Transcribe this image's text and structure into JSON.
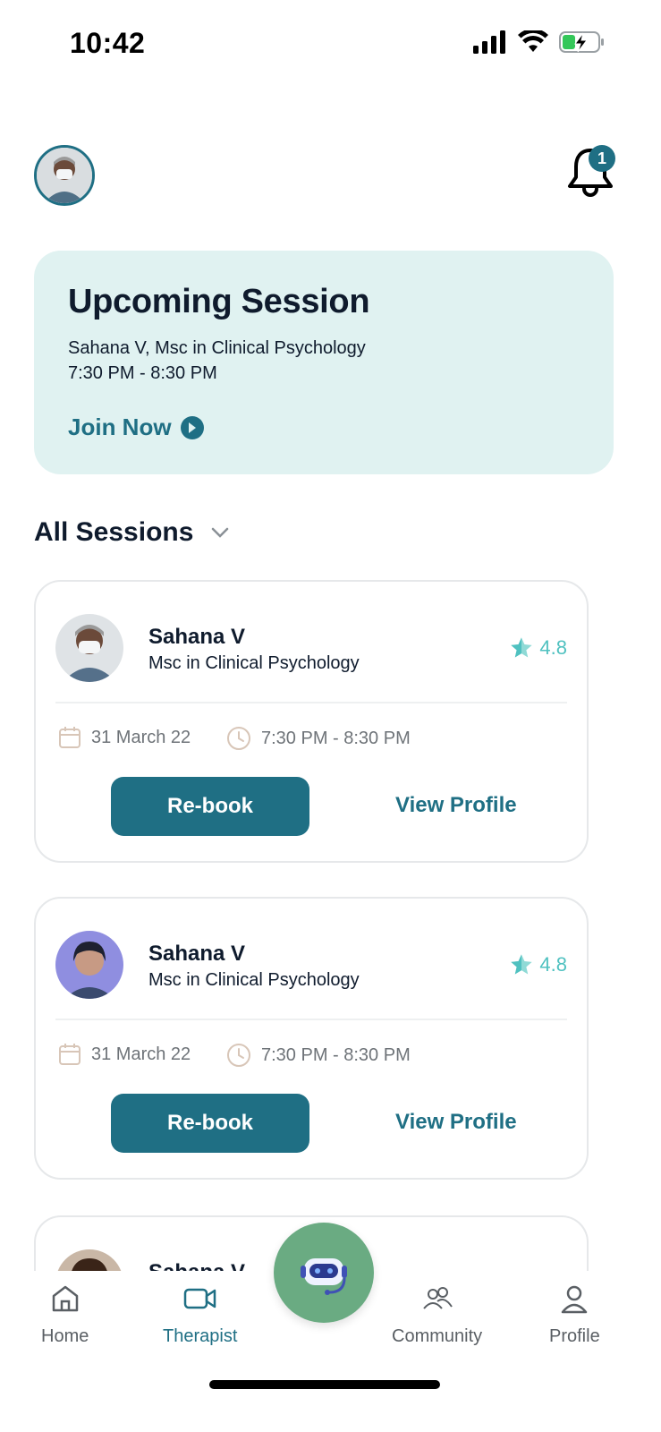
{
  "status_bar": {
    "time": "10:42",
    "icons": [
      "signal-icon",
      "wifi-icon",
      "battery-charging-icon"
    ]
  },
  "header": {
    "avatar": "user-avatar",
    "notifications_count": "1"
  },
  "upcoming": {
    "title": "Upcoming Session",
    "therapist_line": "Sahana V, Msc in Clinical Psychology",
    "time": "7:30 PM - 8:30 PM",
    "join_label": "Join Now"
  },
  "sessions_header": {
    "title": "All Sessions"
  },
  "sessions": [
    {
      "name": "Sahana V",
      "qualification": "Msc in Clinical Psychology",
      "rating": "4.8",
      "date": "31 March 22",
      "time": "7:30 PM - 8:30 PM",
      "rebook_label": "Re-book",
      "view_label": "View Profile"
    },
    {
      "name": "Sahana V",
      "qualification": "Msc in Clinical Psychology",
      "rating": "4.8",
      "date": "31 March 22",
      "time": "7:30 PM - 8:30 PM",
      "rebook_label": "Re-book",
      "view_label": "View Profile"
    },
    {
      "name": "Sahana V"
    }
  ],
  "nav": {
    "items": [
      {
        "label": "Home",
        "icon": "home-icon"
      },
      {
        "label": "Therapist",
        "icon": "video-icon",
        "active": true
      },
      {
        "label": "Community",
        "icon": "people-icon"
      },
      {
        "label": "Profile",
        "icon": "person-icon"
      }
    ],
    "fab_icon": "robot-assistant-icon"
  },
  "colors": {
    "primary": "#1f6f84",
    "card_bg": "#e0f2f1",
    "rating": "#4fc1c0",
    "fab": "#6aab82"
  }
}
